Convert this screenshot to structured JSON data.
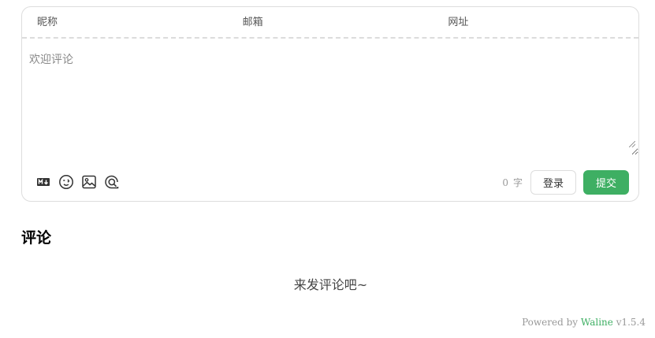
{
  "form": {
    "fields": [
      {
        "placeholder": "昵称"
      },
      {
        "placeholder": "邮箱"
      },
      {
        "placeholder": "网址"
      }
    ],
    "editor_placeholder": "欢迎评论",
    "word_count": "0",
    "word_unit": "字",
    "login_label": "登录",
    "submit_label": "提交",
    "toolbar": [
      "markdown-icon",
      "emoji-icon",
      "image-icon",
      "preview-icon"
    ],
    "accent_color": "#3eaf63"
  },
  "comments": {
    "title": "评论",
    "empty_message": "来发评论吧~"
  },
  "footer": {
    "powered_by": "Powered by",
    "brand": "Waline",
    "version": "v1.5.4"
  }
}
